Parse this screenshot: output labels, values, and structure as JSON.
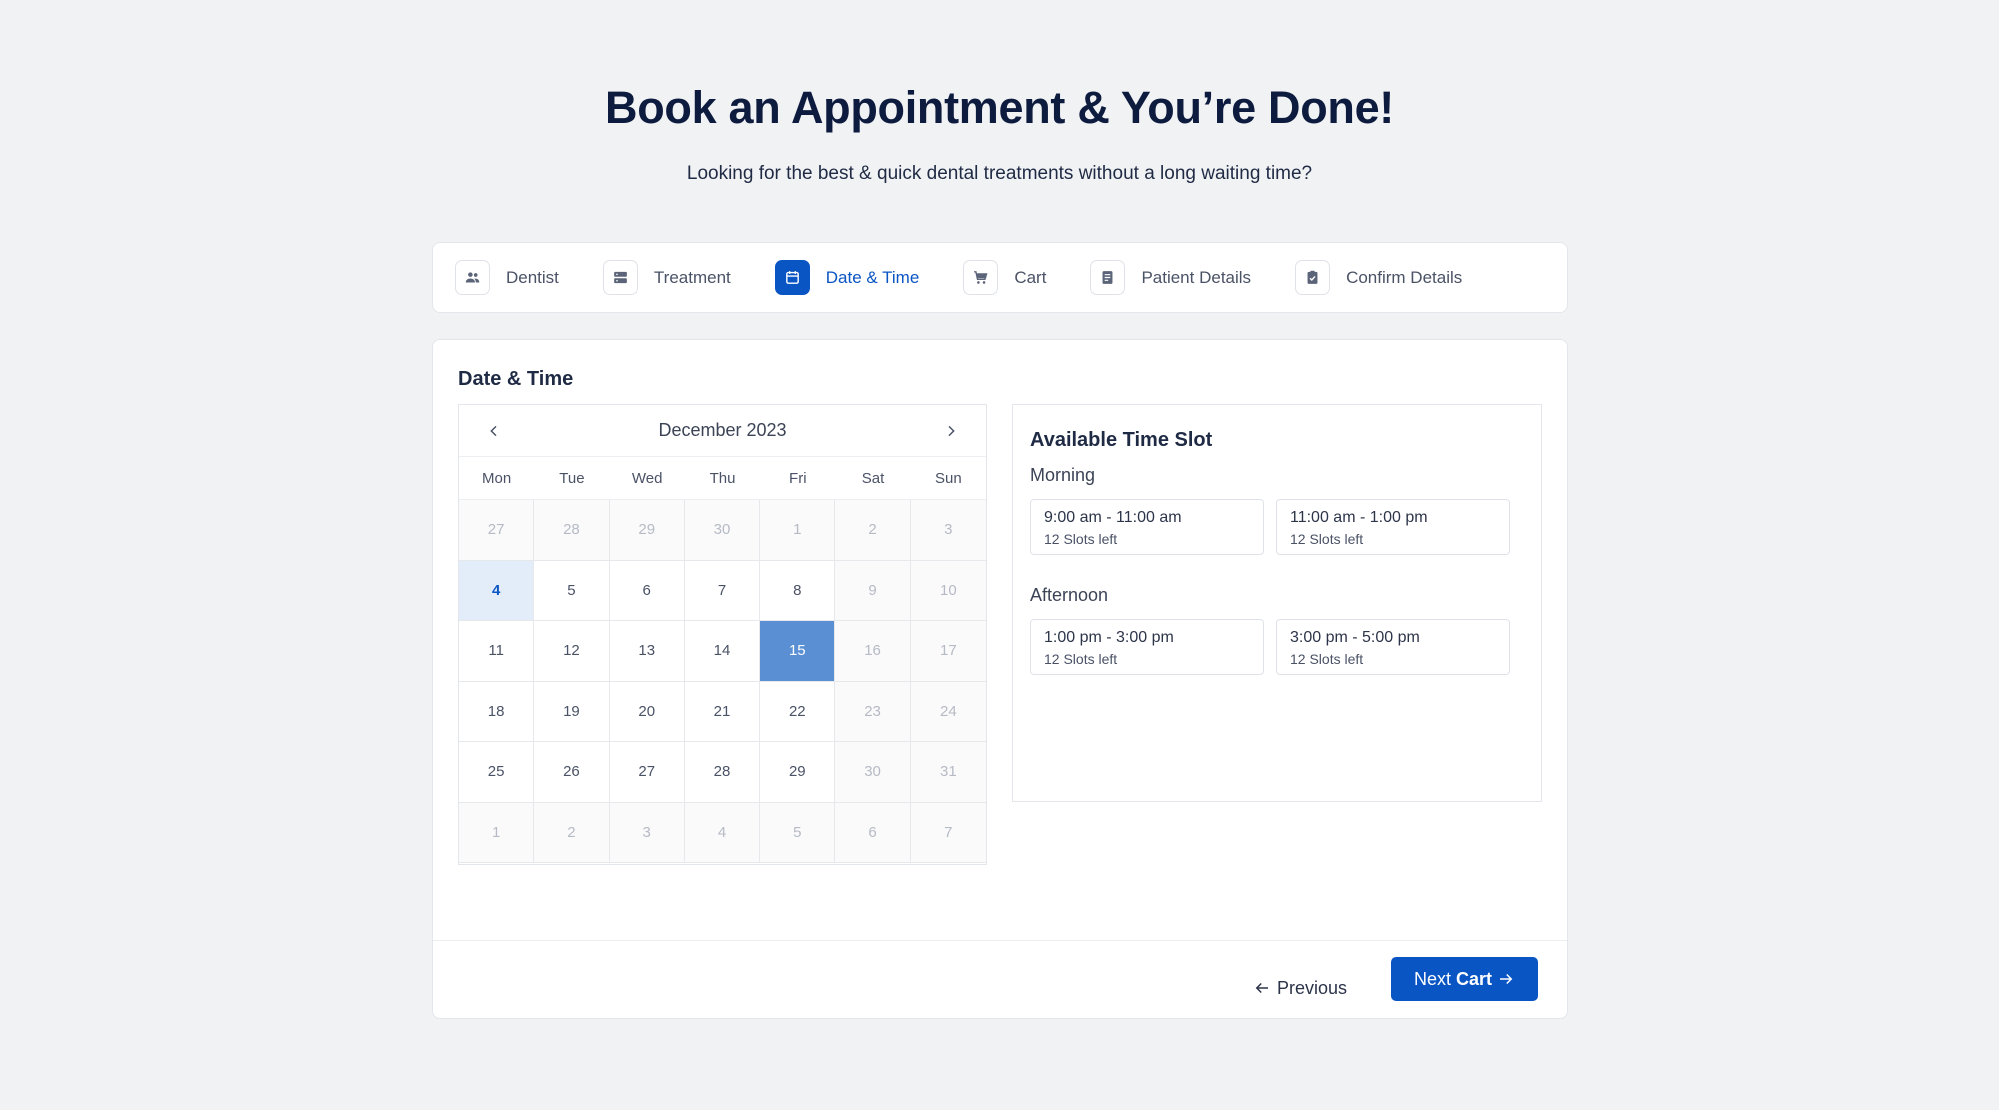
{
  "hero": {
    "title": "Book an Appointment & You’re Done!",
    "subtitle": "Looking for the best & quick dental treatments without a long waiting time?"
  },
  "stepper": {
    "steps": [
      {
        "label": "Dentist",
        "icon": "users-icon"
      },
      {
        "label": "Treatment",
        "icon": "server-icon"
      },
      {
        "label": "Date & Time",
        "icon": "calendar-icon",
        "active": true
      },
      {
        "label": "Cart",
        "icon": "cart-icon"
      },
      {
        "label": "Patient Details",
        "icon": "document-icon"
      },
      {
        "label": "Confirm Details",
        "icon": "clipboard-check-icon"
      }
    ]
  },
  "card": {
    "title": "Date & Time"
  },
  "calendar": {
    "month": "December 2023",
    "weekdays": [
      "Mon",
      "Tue",
      "Wed",
      "Thu",
      "Fri",
      "Sat",
      "Sun"
    ],
    "days": [
      {
        "d": "27",
        "muted": true
      },
      {
        "d": "28",
        "muted": true
      },
      {
        "d": "29",
        "muted": true
      },
      {
        "d": "30",
        "muted": true
      },
      {
        "d": "1",
        "muted": true
      },
      {
        "d": "2",
        "muted": true
      },
      {
        "d": "3",
        "muted": true
      },
      {
        "d": "4",
        "today": true
      },
      {
        "d": "5"
      },
      {
        "d": "6"
      },
      {
        "d": "7"
      },
      {
        "d": "8"
      },
      {
        "d": "9",
        "weekend": true
      },
      {
        "d": "10",
        "weekend": true
      },
      {
        "d": "11"
      },
      {
        "d": "12"
      },
      {
        "d": "13"
      },
      {
        "d": "14"
      },
      {
        "d": "15",
        "selected": true
      },
      {
        "d": "16",
        "weekend": true
      },
      {
        "d": "17",
        "weekend": true
      },
      {
        "d": "18"
      },
      {
        "d": "19"
      },
      {
        "d": "20"
      },
      {
        "d": "21"
      },
      {
        "d": "22"
      },
      {
        "d": "23",
        "weekend": true
      },
      {
        "d": "24",
        "weekend": true
      },
      {
        "d": "25"
      },
      {
        "d": "26"
      },
      {
        "d": "27"
      },
      {
        "d": "28"
      },
      {
        "d": "29"
      },
      {
        "d": "30",
        "weekend": true
      },
      {
        "d": "31",
        "weekend": true
      },
      {
        "d": "1",
        "muted": true
      },
      {
        "d": "2",
        "muted": true
      },
      {
        "d": "3",
        "muted": true
      },
      {
        "d": "4",
        "muted": true
      },
      {
        "d": "5",
        "muted": true
      },
      {
        "d": "6",
        "muted": true
      },
      {
        "d": "7",
        "muted": true
      }
    ]
  },
  "slots": {
    "title": "Available Time Slot",
    "morning": {
      "label": "Morning",
      "items": [
        {
          "time": "9:00 am - 11:00 am",
          "left": "12 Slots left"
        },
        {
          "time": "11:00 am - 1:00 pm",
          "left": "12 Slots left"
        }
      ]
    },
    "afternoon": {
      "label": "Afternoon",
      "items": [
        {
          "time": "1:00 pm - 3:00 pm",
          "left": "12 Slots left"
        },
        {
          "time": "3:00 pm - 5:00 pm",
          "left": "12 Slots left"
        }
      ]
    }
  },
  "footer": {
    "previous_label": "Previous",
    "next_label": "Next",
    "next_bold": "Cart"
  },
  "colors": {
    "accent": "#0a55c4",
    "selected_day": "#5b8fd4",
    "today_bg": "#e3edf9",
    "page_bg": "#f1f2f4"
  }
}
